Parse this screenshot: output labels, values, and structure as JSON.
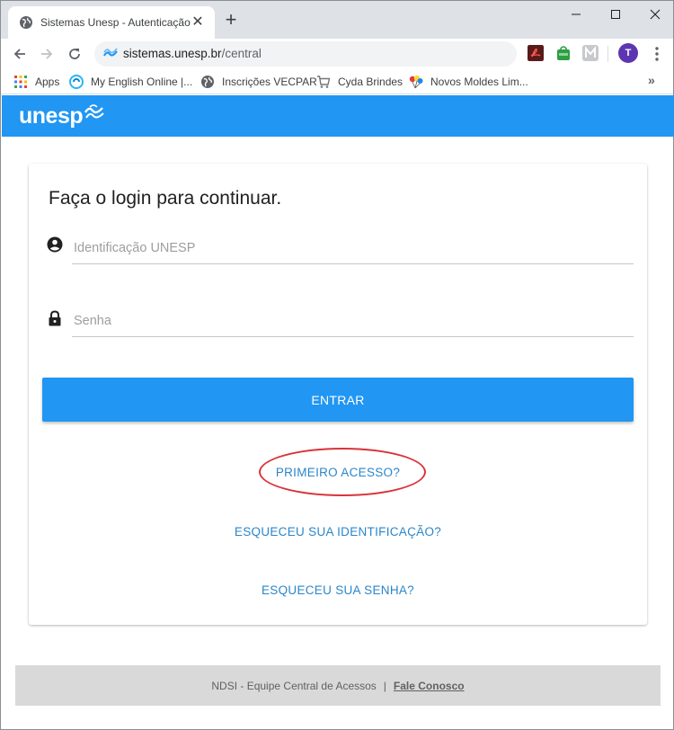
{
  "browser": {
    "tab_title": "Sistemas Unesp - Autenticação",
    "tab_close": "✕",
    "new_tab": "+",
    "url_host": "sistemas.unesp.br",
    "url_path": "/central",
    "profile_initial": "T",
    "bookmarks": [
      {
        "label": "Apps",
        "icon": "apps-grid-icon"
      },
      {
        "label": "My English Online |...",
        "icon": "english-online-icon"
      },
      {
        "label": "Inscrições VECPAR",
        "icon": "globe-icon"
      },
      {
        "label": "Cyda Brindes",
        "icon": "cart-icon"
      },
      {
        "label": "Novos Moldes Lim...",
        "icon": "balloons-icon"
      }
    ],
    "bookmarks_more": "»",
    "extensions": [
      "pdf-extension-icon",
      "green-bag-extension-icon",
      "m-extension-icon"
    ],
    "colors": {
      "tabstrip": "#dee1e6",
      "profile": "#5e35b1"
    }
  },
  "page": {
    "brand": "unesp",
    "brand_color": "#2196f3",
    "login_title": "Faça o login para continuar.",
    "identification_placeholder": "Identificação UNESP",
    "password_placeholder": "Senha",
    "submit_label": "ENTRAR",
    "first_access_link": "PRIMEIRO ACESSO?",
    "forgot_id_link": "ESQUECEU SUA IDENTIFICAÇÃO?",
    "forgot_password_link": "ESQUECEU SUA SENHA?",
    "annotation_color": "#d9333a"
  },
  "footer": {
    "team": "NDSI - Equipe Central de Acessos",
    "separator": "|",
    "contact": "Fale Conosco"
  }
}
